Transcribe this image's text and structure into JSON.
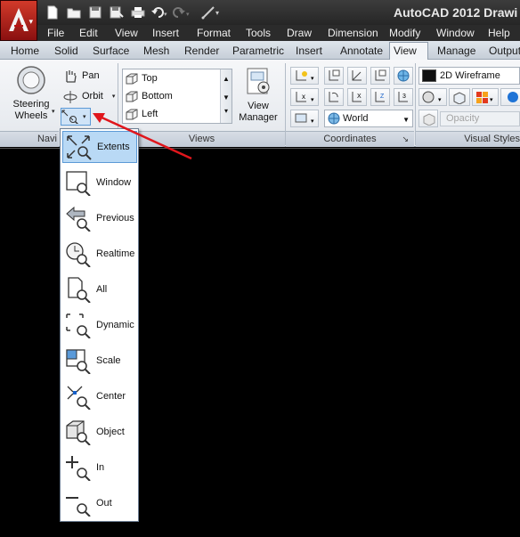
{
  "window": {
    "title": "AutoCAD 2012   Drawi"
  },
  "quick_access": [
    "new-icon",
    "open-icon",
    "save-icon",
    "save-as-icon",
    "plot-icon",
    "undo-icon",
    "redo-icon",
    "match-properties-icon"
  ],
  "menu": [
    "File",
    "Edit",
    "View",
    "Insert",
    "Format",
    "Tools",
    "Draw",
    "Dimension",
    "Modify",
    "Window",
    "Help"
  ],
  "tabs": [
    "Home",
    "Solid",
    "Surface",
    "Mesh",
    "Render",
    "Parametric",
    "Insert",
    "Annotate",
    "View",
    "Manage",
    "Output"
  ],
  "active_tab": "View",
  "navigate": {
    "steering_wheels": "Steering\nWheels",
    "pan": "Pan",
    "orbit": "Orbit",
    "panel_label": "Navi"
  },
  "views": {
    "items": [
      "Top",
      "Bottom",
      "Left"
    ],
    "view_manager": "View\nManager",
    "panel_label": "Views"
  },
  "coordinates": {
    "world": "World",
    "panel_label": "Coordinates"
  },
  "visual_styles": {
    "current": "2D Wireframe",
    "opacity_placeholder": "Opacity",
    "panel_label": "Visual Styles"
  },
  "zoom_menu": {
    "items": [
      "Extents",
      "Window",
      "Previous",
      "Realtime",
      "All",
      "Dynamic",
      "Scale",
      "Center",
      "Object",
      "In",
      "Out"
    ],
    "selected": "Extents"
  },
  "colors": {
    "accent_red": "#e0161c",
    "selection": "#b9d9f5"
  }
}
